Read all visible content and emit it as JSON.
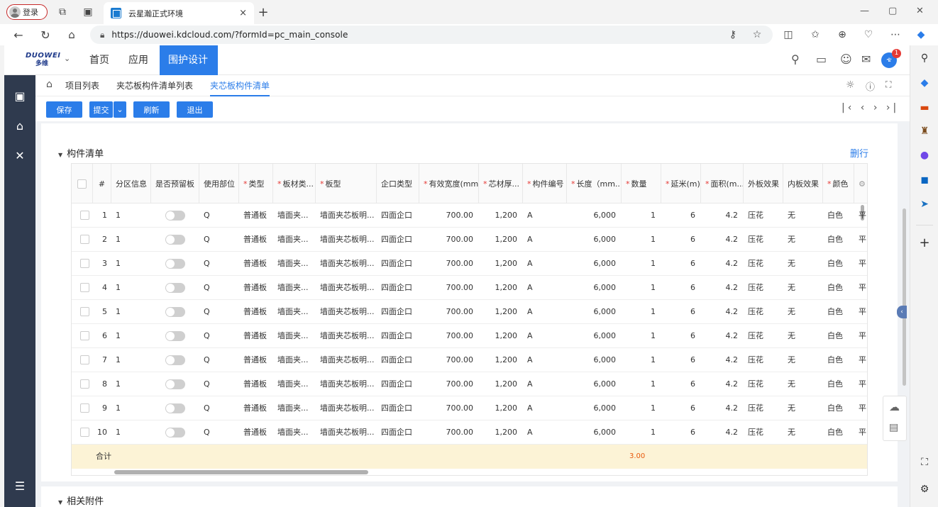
{
  "browser": {
    "login_label": "登录",
    "tab_title": "云星瀚正式环境",
    "tab_close": "×",
    "new_tab": "+",
    "url": "https://duowei.kdcloud.com/?formId=pc_main_console",
    "window_controls": [
      "—",
      "▢",
      "✕"
    ],
    "edge_sidebar_icons": [
      "search-icon",
      "tag-icon",
      "toolbox-icon",
      "chess-icon",
      "copilot-icon",
      "outlook-icon",
      "send-icon",
      "add-icon",
      "screenshot-icon",
      "settings-icon"
    ]
  },
  "app": {
    "logo_top": "DUOWEI",
    "logo_bottom": "多维",
    "nav": [
      "首页",
      "应用",
      "围护设计"
    ],
    "notification_count": "1",
    "avatar_text": "ቴ",
    "breadcrumb": [
      "项目列表",
      "夹芯板构件清单列表",
      "夹芯板构件清单"
    ],
    "toolbar": {
      "save": "保存",
      "submit": "提交",
      "refresh": "刷新",
      "exit": "退出"
    },
    "pager_icons": "|‹ ‹ › ›|",
    "section_title": "构件清单",
    "delete_row": "删行",
    "section2_title": "相关附件"
  },
  "grid": {
    "columns": [
      {
        "key": "no",
        "label": "#",
        "required": false
      },
      {
        "key": "zone",
        "label": "分区信息",
        "required": false
      },
      {
        "key": "reserve",
        "label": "是否预留板",
        "required": false
      },
      {
        "key": "part",
        "label": "使用部位",
        "required": false
      },
      {
        "key": "type",
        "label": "类型",
        "required": true
      },
      {
        "key": "material",
        "label": "板材类...",
        "required": true
      },
      {
        "key": "board",
        "label": "板型",
        "required": true
      },
      {
        "key": "edge",
        "label": "企口类型",
        "required": false
      },
      {
        "key": "width",
        "label": "有效宽度(mm)",
        "required": true
      },
      {
        "key": "core",
        "label": "芯材厚...",
        "required": true
      },
      {
        "key": "code",
        "label": "构件编号",
        "required": true
      },
      {
        "key": "length",
        "label": "长度（mm...",
        "required": true
      },
      {
        "key": "qty",
        "label": "数量",
        "required": true
      },
      {
        "key": "meter",
        "label": "延米(m)",
        "required": true
      },
      {
        "key": "area",
        "label": "面积(m...",
        "required": true
      },
      {
        "key": "outer",
        "label": "外板效果",
        "required": false
      },
      {
        "key": "inner",
        "label": "内板效果",
        "required": false
      },
      {
        "key": "color",
        "label": "颜色",
        "required": true
      }
    ],
    "rows": [
      {
        "no": "1",
        "zone": "1",
        "part": "Q",
        "type": "普通板",
        "material": "墙面夹...",
        "board": "墙面夹芯板明...",
        "edge": "四面企口",
        "width": "700.00",
        "core": "1,200",
        "code": "A",
        "length": "6,000",
        "qty": "1",
        "meter": "6",
        "area": "4.2",
        "outer": "压花",
        "inner": "无",
        "color": "白色",
        "extra": "平"
      },
      {
        "no": "2",
        "zone": "1",
        "part": "Q",
        "type": "普通板",
        "material": "墙面夹...",
        "board": "墙面夹芯板明...",
        "edge": "四面企口",
        "width": "700.00",
        "core": "1,200",
        "code": "A",
        "length": "6,000",
        "qty": "1",
        "meter": "6",
        "area": "4.2",
        "outer": "压花",
        "inner": "无",
        "color": "白色",
        "extra": "平"
      },
      {
        "no": "3",
        "zone": "1",
        "part": "Q",
        "type": "普通板",
        "material": "墙面夹...",
        "board": "墙面夹芯板明...",
        "edge": "四面企口",
        "width": "700.00",
        "core": "1,200",
        "code": "A",
        "length": "6,000",
        "qty": "1",
        "meter": "6",
        "area": "4.2",
        "outer": "压花",
        "inner": "无",
        "color": "白色",
        "extra": "平"
      },
      {
        "no": "4",
        "zone": "1",
        "part": "Q",
        "type": "普通板",
        "material": "墙面夹...",
        "board": "墙面夹芯板明...",
        "edge": "四面企口",
        "width": "700.00",
        "core": "1,200",
        "code": "A",
        "length": "6,000",
        "qty": "1",
        "meter": "6",
        "area": "4.2",
        "outer": "压花",
        "inner": "无",
        "color": "白色",
        "extra": "平"
      },
      {
        "no": "5",
        "zone": "1",
        "part": "Q",
        "type": "普通板",
        "material": "墙面夹...",
        "board": "墙面夹芯板明...",
        "edge": "四面企口",
        "width": "700.00",
        "core": "1,200",
        "code": "A",
        "length": "6,000",
        "qty": "1",
        "meter": "6",
        "area": "4.2",
        "outer": "压花",
        "inner": "无",
        "color": "白色",
        "extra": "平"
      },
      {
        "no": "6",
        "zone": "1",
        "part": "Q",
        "type": "普通板",
        "material": "墙面夹...",
        "board": "墙面夹芯板明...",
        "edge": "四面企口",
        "width": "700.00",
        "core": "1,200",
        "code": "A",
        "length": "6,000",
        "qty": "1",
        "meter": "6",
        "area": "4.2",
        "outer": "压花",
        "inner": "无",
        "color": "白色",
        "extra": "平"
      },
      {
        "no": "7",
        "zone": "1",
        "part": "Q",
        "type": "普通板",
        "material": "墙面夹...",
        "board": "墙面夹芯板明...",
        "edge": "四面企口",
        "width": "700.00",
        "core": "1,200",
        "code": "A",
        "length": "6,000",
        "qty": "1",
        "meter": "6",
        "area": "4.2",
        "outer": "压花",
        "inner": "无",
        "color": "白色",
        "extra": "平"
      },
      {
        "no": "8",
        "zone": "1",
        "part": "Q",
        "type": "普通板",
        "material": "墙面夹...",
        "board": "墙面夹芯板明...",
        "edge": "四面企口",
        "width": "700.00",
        "core": "1,200",
        "code": "A",
        "length": "6,000",
        "qty": "1",
        "meter": "6",
        "area": "4.2",
        "outer": "压花",
        "inner": "无",
        "color": "白色",
        "extra": "平"
      },
      {
        "no": "9",
        "zone": "1",
        "part": "Q",
        "type": "普通板",
        "material": "墙面夹...",
        "board": "墙面夹芯板明...",
        "edge": "四面企口",
        "width": "700.00",
        "core": "1,200",
        "code": "A",
        "length": "6,000",
        "qty": "1",
        "meter": "6",
        "area": "4.2",
        "outer": "压花",
        "inner": "无",
        "color": "白色",
        "extra": "平"
      },
      {
        "no": "10",
        "zone": "1",
        "part": "Q",
        "type": "普通板",
        "material": "墙面夹...",
        "board": "墙面夹芯板明...",
        "edge": "四面企口",
        "width": "700.00",
        "core": "1,200",
        "code": "A",
        "length": "6,000",
        "qty": "1",
        "meter": "6",
        "area": "4.2",
        "outer": "压花",
        "inner": "无",
        "color": "白色",
        "extra": "平"
      }
    ],
    "sum_label": "合计",
    "sum_qty": "3.00"
  },
  "colors": {
    "accent": "#2b7de9",
    "sidebar": "#2f3a4e",
    "sum_row": "#fcf3d6",
    "required": "#e53935"
  }
}
